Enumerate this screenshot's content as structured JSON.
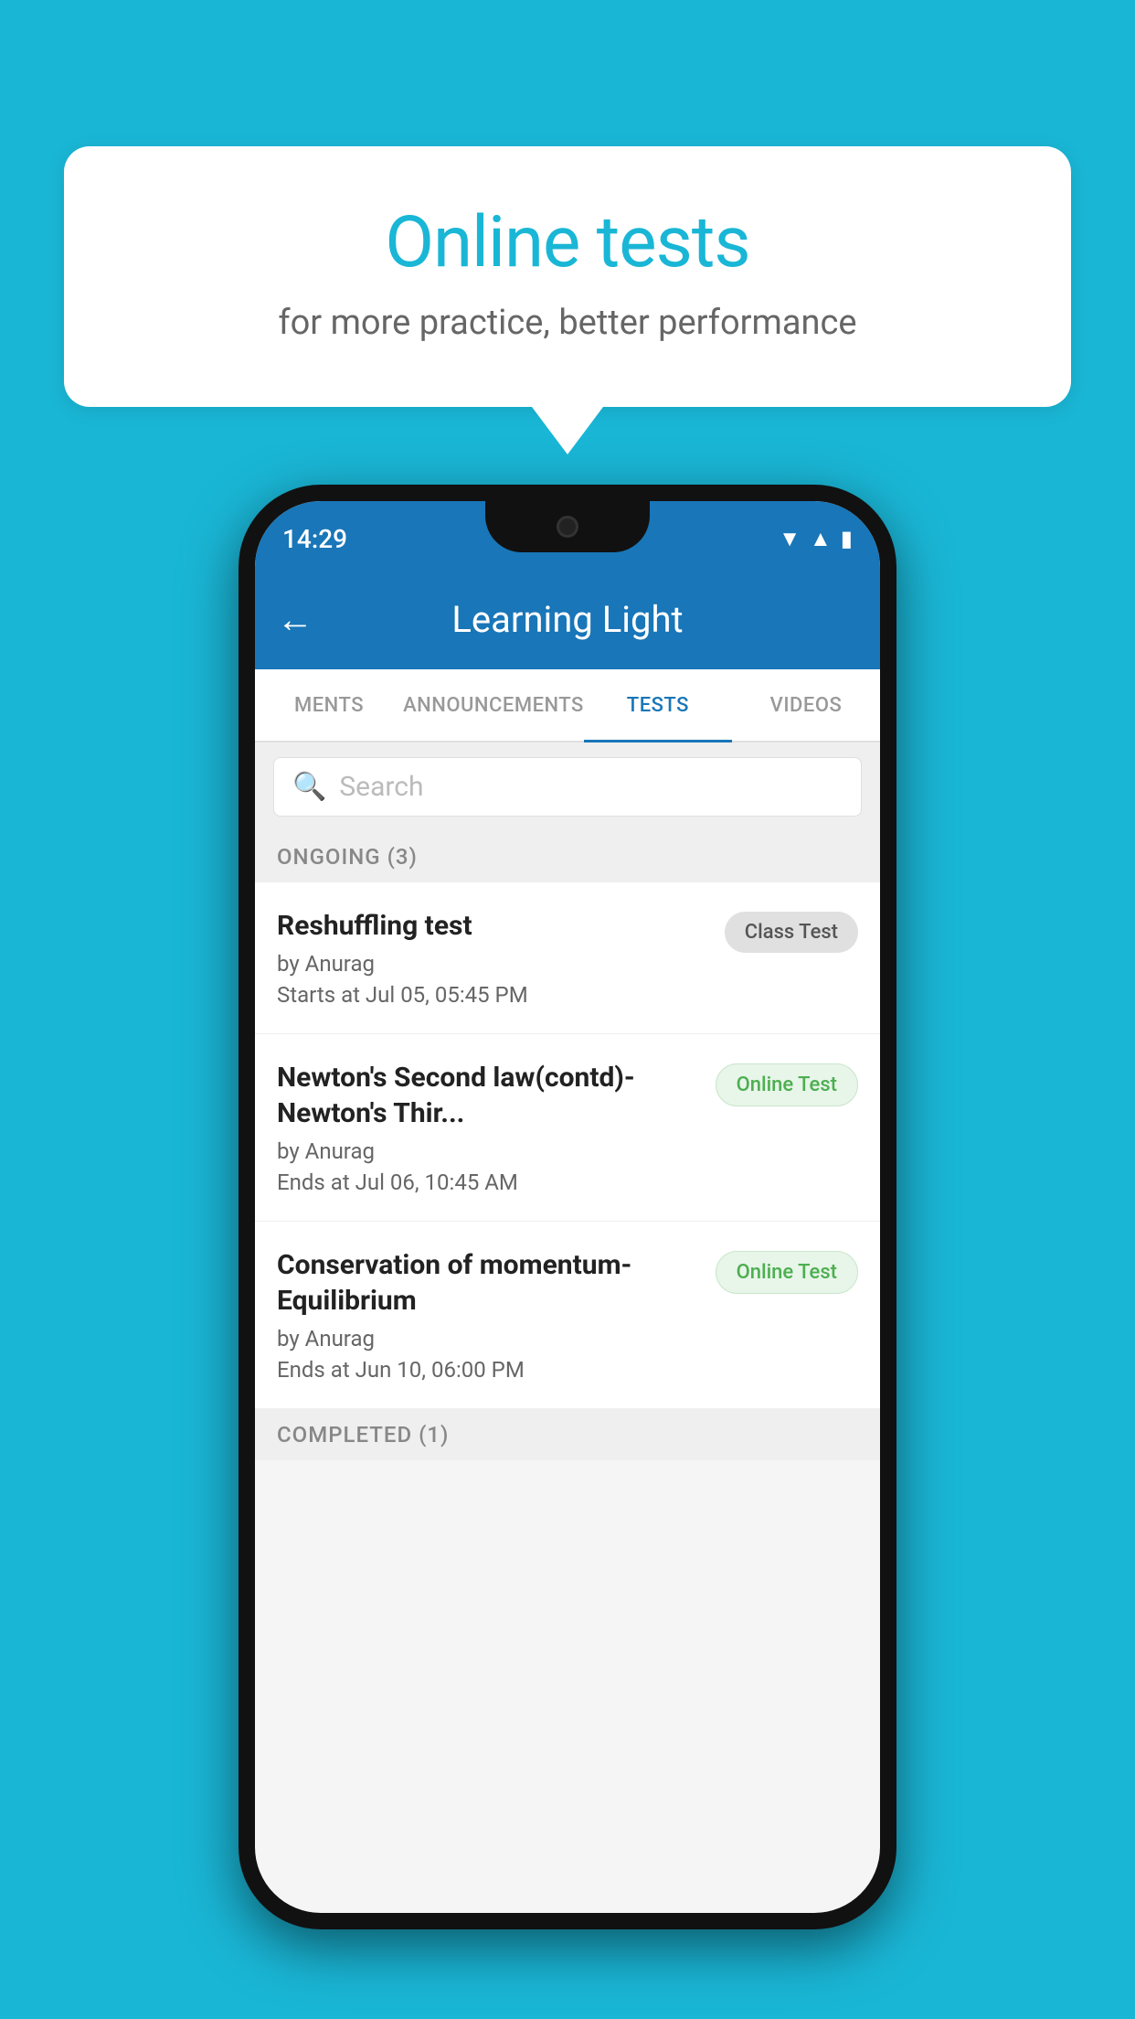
{
  "background": {
    "color": "#1ab6d6"
  },
  "speech_bubble": {
    "title": "Online tests",
    "subtitle": "for more practice, better performance"
  },
  "phone": {
    "status_bar": {
      "time": "14:29",
      "wifi_icon": "▼",
      "signal_icon": "▲",
      "battery_icon": "▮"
    },
    "app_bar": {
      "back_label": "←",
      "title": "Learning Light"
    },
    "tabs": [
      {
        "label": "MENTS",
        "active": false
      },
      {
        "label": "ANNOUNCEMENTS",
        "active": false
      },
      {
        "label": "TESTS",
        "active": true
      },
      {
        "label": "VIDEOS",
        "active": false
      }
    ],
    "search": {
      "placeholder": "Search"
    },
    "ongoing_section": {
      "label": "ONGOING (3)"
    },
    "tests": [
      {
        "name": "Reshuffling test",
        "author": "by Anurag",
        "time": "Starts at  Jul 05, 05:45 PM",
        "badge": "Class Test",
        "badge_type": "class"
      },
      {
        "name": "Newton's Second law(contd)-Newton's Thir...",
        "author": "by Anurag",
        "time": "Ends at  Jul 06, 10:45 AM",
        "badge": "Online Test",
        "badge_type": "online"
      },
      {
        "name": "Conservation of momentum-Equilibrium",
        "author": "by Anurag",
        "time": "Ends at  Jun 10, 06:00 PM",
        "badge": "Online Test",
        "badge_type": "online"
      }
    ],
    "completed_section": {
      "label": "COMPLETED (1)"
    }
  }
}
